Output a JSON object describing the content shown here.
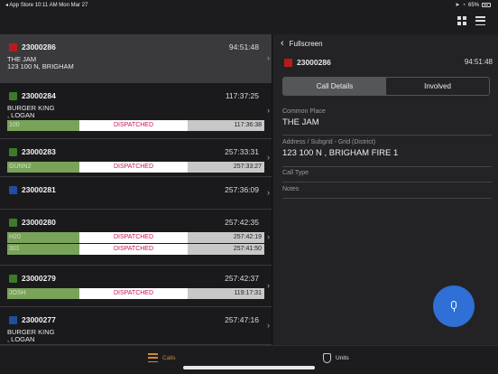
{
  "status_bar": {
    "left": "◂ App Store  10:11 AM   Mon Mar 27",
    "battery": "65%"
  },
  "toolbar": {
    "grid_icon": "grid-icon",
    "menu_icon": "menu-icon"
  },
  "calls": [
    {
      "id": "23000286",
      "time": "94:51:48",
      "color": "#b71c1c",
      "addr1": "THE JAM",
      "addr2": "123 100 N, BRIGHAM",
      "units": []
    },
    {
      "id": "23000284",
      "time": "117:37:25",
      "color": "#3d7a2a",
      "addr1": "BURGER KING",
      "addr2": ", LOGAN",
      "units": [
        {
          "unit": "100",
          "status": "DISPATCHED",
          "time": "117:36:38"
        }
      ]
    },
    {
      "id": "23000283",
      "time": "257:33:31",
      "color": "#3d7a2a",
      "addr1": "",
      "addr2": "",
      "units": [
        {
          "unit": "GUNN2",
          "status": "DISPATCHED",
          "time": "257:33:27"
        }
      ]
    },
    {
      "id": "23000281",
      "time": "257:36:09",
      "color": "#1e4fa0",
      "addr1": "",
      "addr2": "",
      "units": []
    },
    {
      "id": "23000280",
      "time": "257:42:35",
      "color": "#3d7a2a",
      "addr1": "",
      "addr2": "",
      "units": [
        {
          "unit": "H20",
          "status": "DISPATCHED",
          "time": "257:42:19"
        },
        {
          "unit": "301",
          "status": "DISPATCHED",
          "time": "257:41:50"
        }
      ]
    },
    {
      "id": "23000279",
      "time": "257:42:37",
      "color": "#3d7a2a",
      "addr1": "",
      "addr2": "",
      "units": [
        {
          "unit": "JOSH",
          "status": "DISPATCHED",
          "time": "119:17:31"
        }
      ]
    },
    {
      "id": "23000277",
      "time": "257:47:16",
      "color": "#1e4fa0",
      "addr1": "BURGER KING",
      "addr2": ", LOGAN",
      "units": []
    }
  ],
  "detail": {
    "back_label": "Fullscreen",
    "id": "23000286",
    "time": "94:51:48",
    "color": "#b71c1c",
    "tabs": [
      "Call Details",
      "Involved"
    ],
    "fields": {
      "common_place_label": "Common Place",
      "common_place_value": "THE JAM",
      "address_label": "Address / Subgrid - Grid (District)",
      "address_value": "123 100 N , BRIGHAM FIRE 1",
      "call_type_label": "Call Type",
      "notes_label": "Notes"
    }
  },
  "tabbar": {
    "calls": "Calls",
    "units": "Units"
  }
}
